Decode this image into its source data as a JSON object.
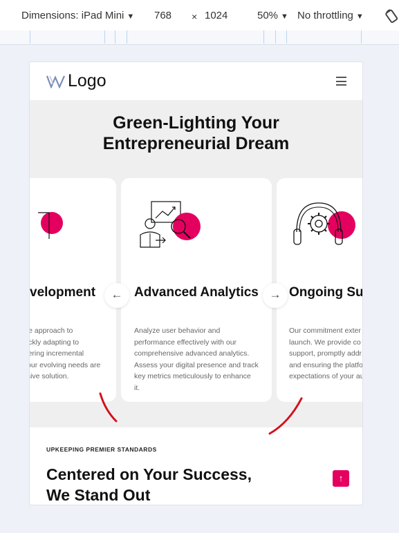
{
  "devtools": {
    "dimensions_label": "Dimensions: iPad Mini",
    "width": "768",
    "times": "×",
    "height": "1024",
    "zoom": "50%",
    "throttling": "No throttling"
  },
  "site": {
    "logo_text": "Logo",
    "hero_title_line1": "Green-Lighting Your",
    "hero_title_line2": "Entrepreneurial Dream",
    "cards": [
      {
        "title": "velopment",
        "desc_lines": [
          "ble approach to",
          "uickly adapting to",
          "ivering incremental",
          "Your evolving needs are",
          "nsive solution."
        ]
      },
      {
        "title": "Advanced Analytics",
        "desc_lines": [
          "Analyze user behavior and",
          "performance effectively with our",
          "comprehensive advanced analytics.",
          "Assess your digital presence and track",
          "key metrics meticulously to enhance",
          "it."
        ]
      },
      {
        "title": "Ongoing Sup",
        "desc_lines": [
          "Our commitment exter",
          "launch. We provide co",
          "support, promptly addr",
          "and ensuring the platfo",
          "expectations of your au"
        ]
      }
    ],
    "prev_arrow": "←",
    "next_arrow": "→",
    "eyebrow": "UPKEEPING PREMIER STANDARDS",
    "section_title_line1": "Centered on Your Success,",
    "section_title_line2": "We Stand Out",
    "to_top_icon": "↑"
  },
  "colors": {
    "accent": "#e4005f",
    "annotation": "#d4101c",
    "hero_bg": "#efefef"
  },
  "icons": [
    "chevron-down-icon",
    "rotate-icon",
    "hamburger-menu-icon",
    "analytics-icon",
    "headset-gear-icon",
    "arrow-left-icon",
    "arrow-right-icon",
    "arrow-up-icon"
  ]
}
